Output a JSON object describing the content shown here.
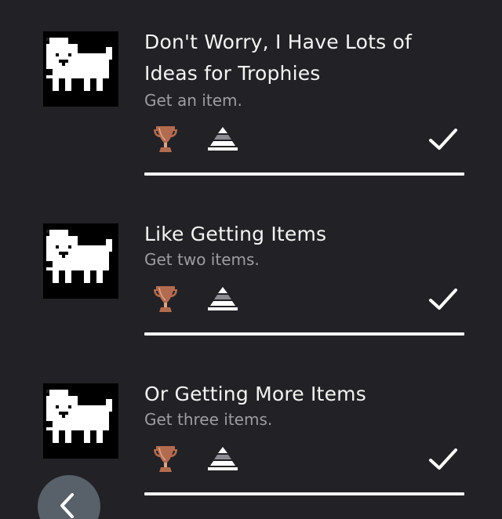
{
  "trophies": [
    {
      "title": "Don't Worry, I Have Lots of Ideas for Trophies",
      "description": "Get an item.",
      "grade": "bronze",
      "grade_color": "#b36b4f",
      "rarity_icon": "rarity-common-icon",
      "earned": true,
      "progress": 1.0
    },
    {
      "title": "Like Getting Items",
      "description": "Get two items.",
      "grade": "bronze",
      "grade_color": "#b36b4f",
      "rarity_icon": "rarity-common-icon",
      "earned": true,
      "progress": 1.0
    },
    {
      "title": "Or Getting More Items",
      "description": "Get three items.",
      "grade": "bronze",
      "grade_color": "#b36b4f",
      "rarity_icon": "rarity-common-icon",
      "earned": true,
      "progress": 1.0
    }
  ],
  "navigation": {
    "back_icon": "chevron-left-icon"
  },
  "colors": {
    "background": "#222125",
    "title_text": "#f4f4f4",
    "description_text": "#9d9da2",
    "back_button": "#58606a"
  }
}
